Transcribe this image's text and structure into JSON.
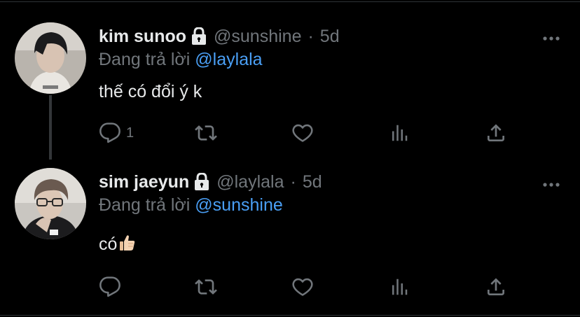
{
  "tweets": [
    {
      "name": "kim sunoo",
      "handle": "@sunshine",
      "separator": "·",
      "time": "5d",
      "reply_prefix": "Đang trả lời",
      "reply_to": "@laylala",
      "text": "thế có đổi ý k",
      "reply_count": "1",
      "protected": true
    },
    {
      "name": "sim jaeyun",
      "handle": "@laylala",
      "separator": "·",
      "time": "5d",
      "reply_prefix": "Đang trả lời",
      "reply_to": "@sunshine",
      "text": "có",
      "emoji": "thumbs-up",
      "reply_count": "",
      "protected": true
    }
  ],
  "colors": {
    "background": "#000000",
    "primary_text": "#e7e9ea",
    "secondary_text": "#71767b",
    "mention": "#4a9ff5",
    "icon": "#71767b",
    "divider": "#2f3336"
  },
  "icons": {
    "lock": "lock-icon",
    "more": "more-icon",
    "reply": "reply-icon",
    "retweet": "retweet-icon",
    "like": "heart-icon",
    "views": "views-icon",
    "share": "share-icon"
  }
}
